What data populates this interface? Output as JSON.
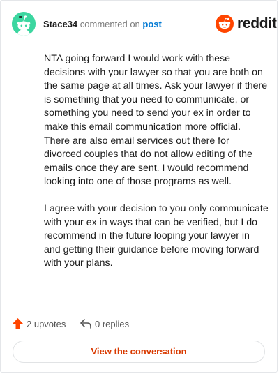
{
  "header": {
    "username": "Stace34",
    "action_text": "commented on",
    "post_link": "post",
    "brand": "reddit"
  },
  "comment": {
    "paragraphs": [
      "NTA going forward I would work with these decisions with your lawyer so that you are both on the same page at all times. Ask your lawyer if there is something that you need to communicate, or something you need to send your ex in order to make this email communication more official. There are also email services out there for divorced couples that do not allow editing of the emails once they are sent. I would recommend looking into one of those programs as well.",
      "I agree with your decision to you only communicate with your ex in ways that can be verified, but I do recommend in the future looping your lawyer in and getting their guidance before moving forward with your plans."
    ]
  },
  "actions": {
    "upvotes": "2 upvotes",
    "replies": "0 replies"
  },
  "footer": {
    "view_button": "View the conversation"
  },
  "colors": {
    "brand_orange": "#ff4500",
    "link_blue": "#0079d3",
    "button_text": "#d93a00",
    "avatar_bg": "#3cd6a0"
  },
  "icons": [
    "snoo-avatar-icon",
    "reddit-logo-icon",
    "upvote-arrow-icon",
    "reply-arrow-icon"
  ]
}
